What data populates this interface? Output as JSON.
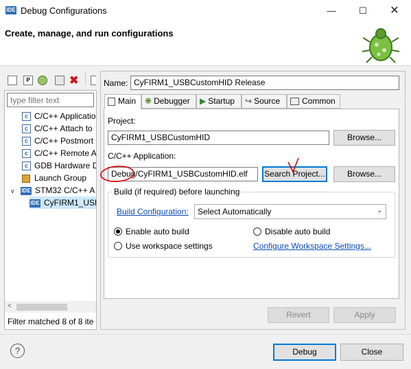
{
  "window": {
    "title": "Debug Configurations",
    "icon_label": "IDE"
  },
  "header": {
    "title": "Create, manage, and run configurations"
  },
  "left": {
    "filter_placeholder": "type filter text",
    "tree": [
      {
        "label": "C/C++ Applicatio",
        "icon": "c-config-icon"
      },
      {
        "label": "C/C++ Attach to",
        "icon": "c-config-icon"
      },
      {
        "label": "C/C++ Postmort",
        "icon": "c-config-icon"
      },
      {
        "label": "C/C++ Remote A",
        "icon": "c-config-icon"
      },
      {
        "label": "GDB Hardware D",
        "icon": "c-config-icon"
      },
      {
        "label": "Launch Group",
        "icon": "launch-group-icon"
      },
      {
        "label": "STM32 C/C++ A",
        "icon": "ide-icon"
      },
      {
        "label": "CyFIRM1_USB",
        "icon": "ide-icon"
      }
    ],
    "status": "Filter matched 8 of 8 ite"
  },
  "config": {
    "name_label": "Name:",
    "name_value": "CyFIRM1_USBCustomHID Release",
    "tabs": [
      {
        "label": "Main",
        "icon": "main-tab-icon"
      },
      {
        "label": "Debugger",
        "icon": "bug-icon"
      },
      {
        "label": "Startup",
        "icon": "startup-icon"
      },
      {
        "label": "Source",
        "icon": "source-icon"
      },
      {
        "label": "Common",
        "icon": "common-icon"
      }
    ],
    "project_label": "Project:",
    "project_value": "CyFIRM1_USBCustomHID",
    "browse_label": "Browse...",
    "app_label": "C/C++ Application:",
    "app_value": "Debug/CyFIRM1_USBCustomHID.elf",
    "search_project_label": "Search Project...",
    "build_group_label": "Build (if required) before launching",
    "build_config_link": "Build Configuration:",
    "build_config_value": "Select Automatically",
    "enable_auto_build": "Enable auto build",
    "disable_auto_build": "Disable auto build",
    "use_workspace": "Use workspace settings",
    "configure_workspace_link": "Configure Workspace Settings...",
    "revert_label": "Revert",
    "apply_label": "Apply"
  },
  "footer": {
    "debug_label": "Debug",
    "close_label": "Close"
  },
  "colors": {
    "accent": "#0078d7",
    "link": "#0a49b8",
    "annotation": "#e00000"
  }
}
